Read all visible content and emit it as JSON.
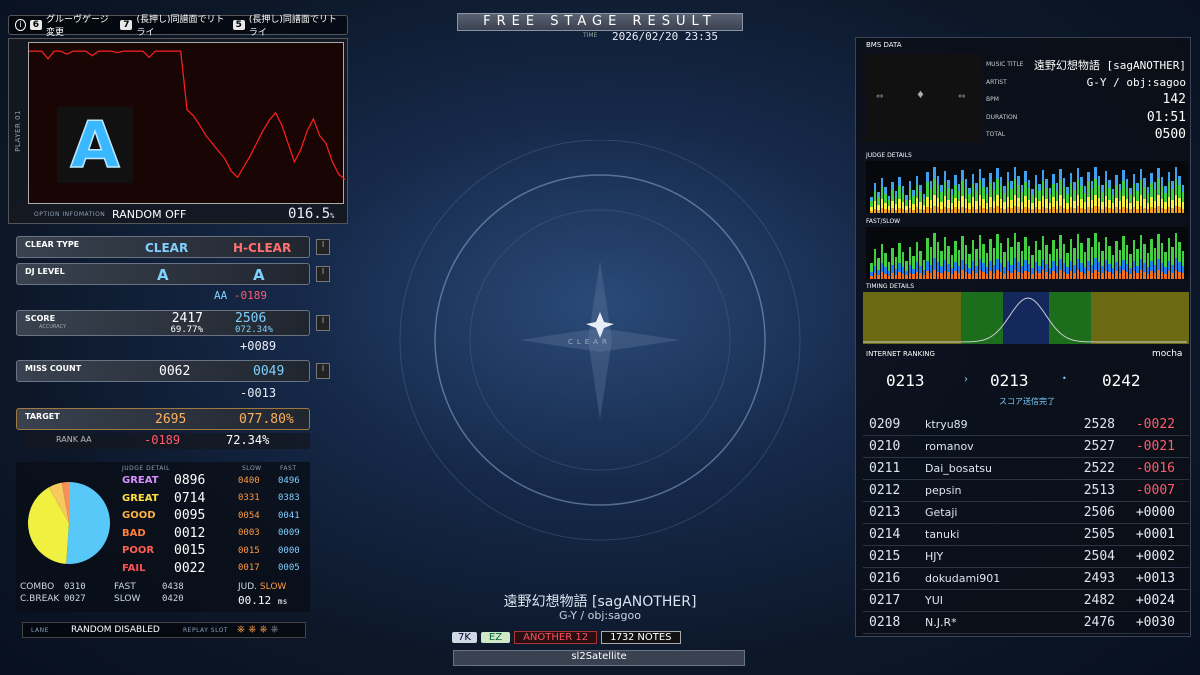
{
  "header": {
    "title": "FREE STAGE RESULT",
    "time_label": "TIME",
    "timestamp": "2026/02/20 23:35"
  },
  "hints": [
    {
      "key": "6",
      "label": "グルーヴゲージ変更"
    },
    {
      "key": "7",
      "label": "(長押し)同譜面でリトライ"
    },
    {
      "key": "5",
      "label": "(長押し)同譜面でリトライ"
    }
  ],
  "emblem": {
    "label": "CLEAR"
  },
  "gauge": {
    "player_label": "PLAYER 01",
    "option_label": "OPTION INFOMATION",
    "option_value": "RANDOM OFF",
    "percent": "016.5",
    "percent_unit": "%",
    "curve": [
      100,
      100,
      100,
      95,
      100,
      100,
      98,
      100,
      100,
      100,
      97,
      100,
      100,
      100,
      99,
      100,
      100,
      100,
      100,
      96,
      100,
      100,
      100,
      100,
      100,
      62,
      58,
      52,
      45,
      40,
      35,
      30,
      22,
      18,
      25,
      32,
      40,
      48,
      55,
      60,
      52,
      40,
      28,
      36,
      48,
      56,
      45,
      40,
      28,
      20,
      16.5
    ]
  },
  "stats": {
    "clear_type": {
      "label": "CLEAR TYPE",
      "sub": "",
      "old": "CLEAR",
      "new": "H-CLEAR"
    },
    "dj_level": {
      "label": "DJ LEVEL",
      "sub": "",
      "old": "A",
      "new": "A",
      "diff_rank": "AA",
      "diff": "-0189"
    },
    "score": {
      "label": "SCORE",
      "sub": "ACCURACY",
      "old": "2417",
      "old_rate": "69.77%",
      "new": "2506",
      "new_rate": "072.34%",
      "diff": "+0089"
    },
    "miss_count": {
      "label": "MISS COUNT",
      "sub": "",
      "old": "0062",
      "new": "0049",
      "diff": "-0013"
    },
    "target": {
      "label": "TARGET",
      "sub": "",
      "score": "2695",
      "rate": "077.80%",
      "rank_label": "RANK AA",
      "rank_diff": "-0189",
      "rank_rate": "72.34%"
    }
  },
  "judge": {
    "header": "JUDGE DETAIL",
    "slow_label": "SLOW",
    "fast_label": "FAST",
    "rows": [
      {
        "name": "GREAT",
        "count": "0896",
        "slow": "0400",
        "fast": "0496",
        "color": "#d890ff"
      },
      {
        "name": "GREAT",
        "count": "0714",
        "slow": "0331",
        "fast": "0383",
        "color": "#ffe040"
      },
      {
        "name": "GOOD",
        "count": "0095",
        "slow": "0054",
        "fast": "0041",
        "color": "#ffb040"
      },
      {
        "name": "BAD",
        "count": "0012",
        "slow": "0003",
        "fast": "0009",
        "color": "#ff8040"
      },
      {
        "name": "POOR",
        "count": "0015",
        "slow": "0015",
        "fast": "0000",
        "color": "#ff6050"
      },
      {
        "name": "FAIL",
        "count": "0022",
        "slow": "0017",
        "fast": "0005",
        "color": "#ff5050"
      }
    ],
    "pie": [
      {
        "value": 896,
        "color": "#58c8f8"
      },
      {
        "value": 714,
        "color": "#f0f040"
      },
      {
        "value": 95,
        "color": "#f8c860"
      },
      {
        "value": 49,
        "color": "#f89058"
      }
    ]
  },
  "summary": {
    "combo_label": "COMBO",
    "combo": "0310",
    "cbreak_label": "C.BREAK",
    "cbreak": "0027",
    "fast_label": "FAST",
    "fast": "0438",
    "slow_label": "SLOW",
    "slow": "0420",
    "jud_label": "JUD.",
    "jud_value": "SLOW",
    "offset": "00.12",
    "offset_unit": "ms"
  },
  "footer": {
    "lane_label": "LANE",
    "lane_value": "RANDOM DISABLED",
    "replay_label": "REPLAY SLOT"
  },
  "song": {
    "title": "遠野幻想物語 [sagANOTHER]",
    "artist": "G-Y / obj:sagoo",
    "key_mode": "7K",
    "gauge": "EZ",
    "difficulty": "ANOTHER",
    "level": "12",
    "notes": "1732",
    "notes_label": "NOTES",
    "skin": "sl2Satellite"
  },
  "bms": {
    "header": "BMS DATA",
    "meta": [
      {
        "label": "MUSIC TITLE",
        "value": "遠野幻想物語 [sagANOTHER]"
      },
      {
        "label": "ARTIST",
        "value": "G-Y / obj:sagoo"
      },
      {
        "label": "BPM",
        "value": "142"
      },
      {
        "label": "DURATION",
        "value": "01:51"
      },
      {
        "label": "TOTAL",
        "value": "0500"
      }
    ],
    "judge_details_label": "JUDGE DETAILS",
    "fast_slow_label": "FAST/SLOW",
    "timing_label": "TIMING DETAILS"
  },
  "ranking": {
    "header": "INTERNET RANKING",
    "player": "mocha",
    "prev_rank": "0213",
    "new_rank": "0213",
    "total": "0242",
    "status": "スコア送信完了",
    "rows": [
      {
        "rank": "0209",
        "name": "ktryu89",
        "score": "2528",
        "diff": "-0022"
      },
      {
        "rank": "0210",
        "name": "romanov",
        "score": "2527",
        "diff": "-0021"
      },
      {
        "rank": "0211",
        "name": "Dai_bosatsu",
        "score": "2522",
        "diff": "-0016"
      },
      {
        "rank": "0212",
        "name": "pepsin",
        "score": "2513",
        "diff": "-0007"
      },
      {
        "rank": "0213",
        "name": "Getaji",
        "score": "2506",
        "diff": "+0000"
      },
      {
        "rank": "0214",
        "name": "tanuki",
        "score": "2505",
        "diff": "+0001"
      },
      {
        "rank": "0215",
        "name": "HJY",
        "score": "2504",
        "diff": "+0002"
      },
      {
        "rank": "0216",
        "name": "dokudami901",
        "score": "2493",
        "diff": "+0013"
      },
      {
        "rank": "0217",
        "name": "YUI",
        "score": "2482",
        "diff": "+0024"
      },
      {
        "rank": "0218",
        "name": "N.J.R*",
        "score": "2476",
        "diff": "+0030"
      }
    ]
  }
}
